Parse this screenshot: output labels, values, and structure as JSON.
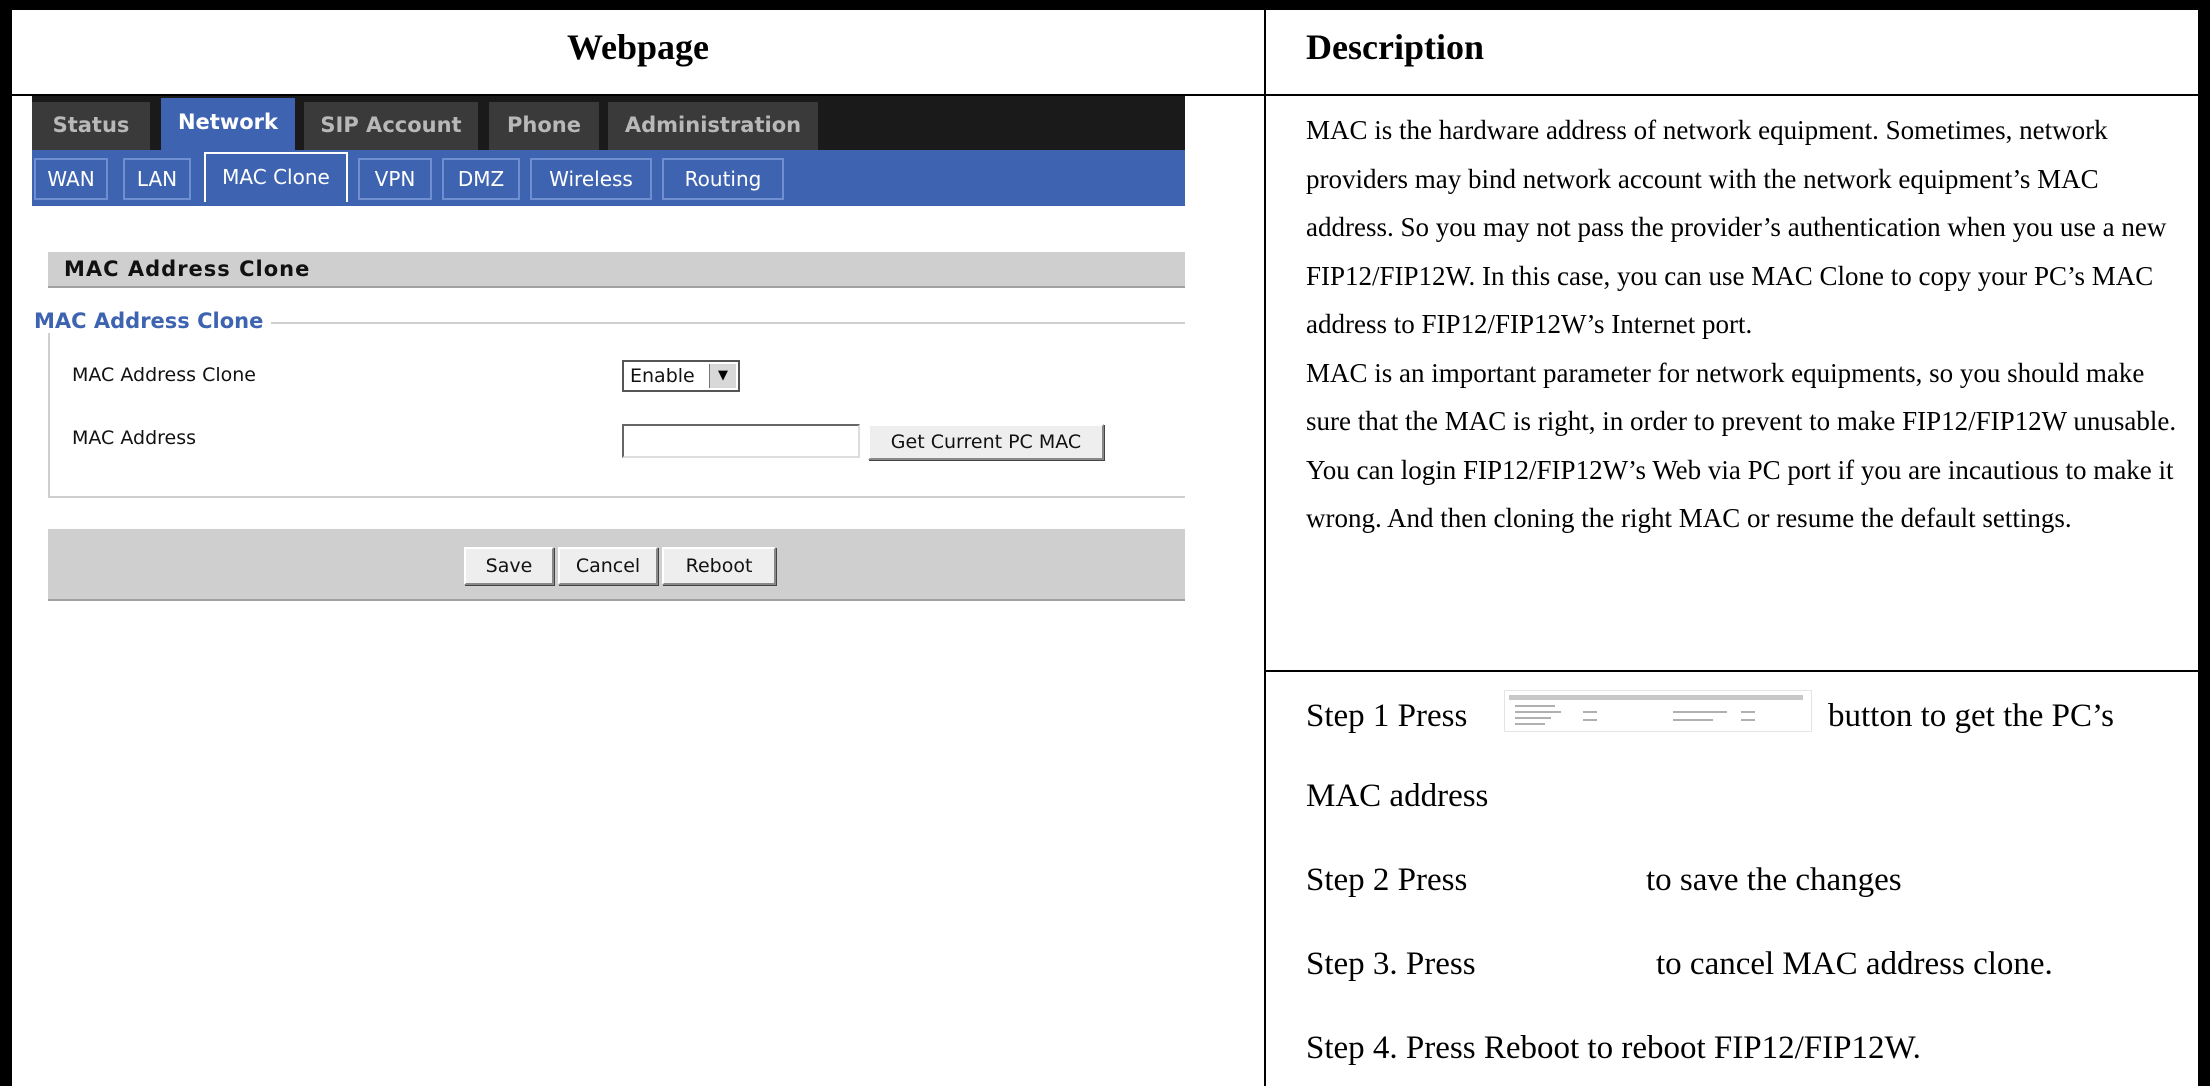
{
  "table": {
    "header_webpage": "Webpage",
    "header_description": "Description"
  },
  "router_ui": {
    "main_tabs": [
      {
        "label": "Status",
        "active": false
      },
      {
        "label": "Network",
        "active": true
      },
      {
        "label": "SIP Account",
        "active": false
      },
      {
        "label": "Phone",
        "active": false
      },
      {
        "label": "Administration",
        "active": false
      }
    ],
    "sub_tabs": [
      {
        "label": "WAN",
        "active": false
      },
      {
        "label": "LAN",
        "active": false
      },
      {
        "label": "MAC Clone",
        "active": true
      },
      {
        "label": "VPN",
        "active": false
      },
      {
        "label": "DMZ",
        "active": false
      },
      {
        "label": "Wireless",
        "active": false
      },
      {
        "label": "Routing",
        "active": false
      }
    ],
    "section_title": "MAC Address Clone",
    "fieldset_legend": "MAC Address Clone",
    "fields": {
      "mac_clone_label": "MAC Address Clone",
      "mac_clone_value": "Enable",
      "mac_address_label": "MAC Address",
      "mac_address_value": ""
    },
    "buttons": {
      "get_mac": "Get Current PC MAC",
      "save": "Save",
      "cancel": "Cancel",
      "reboot": "Reboot"
    },
    "colors": {
      "accent_blue": "#3d63b1",
      "nav_dark": "#1a1a1a",
      "panel_gray": "#cfcfcf"
    }
  },
  "description": {
    "paragraph1": "MAC is the hardware address of network equipment. Sometimes, network providers may bind network account with the network equipment’s MAC address. So you may not pass the provider’s authentication when you use a new FIP12/FIP12W. In this case, you can use MAC Clone to copy your PC’s MAC address to FIP12/FIP12W’s Internet port.",
    "paragraph2": "MAC is an important parameter for network equipments, so you should make sure that the MAC is right, in order to prevent to make FIP12/FIP12W unusable.",
    "paragraph3": "You can login FIP12/FIP12W’s Web via PC port if you are incautious to make it wrong. And then cloning the right MAC or resume the default settings.",
    "steps": {
      "step1_prefix": "Step 1 Press",
      "step1_suffix": "button to get the PC’s",
      "step1_continued": "MAC address",
      "step2_prefix": "Step 2 Press",
      "step2_suffix": "to save the changes",
      "step3_prefix": "Step 3. Press",
      "step3_suffix": "to cancel MAC address clone.",
      "step4": "Step 4. Press Reboot to reboot FIP12/FIP12W."
    }
  }
}
